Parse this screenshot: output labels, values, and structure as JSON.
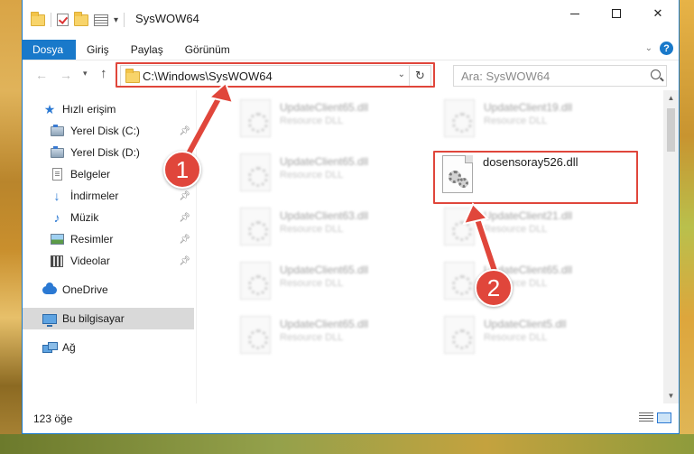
{
  "window": {
    "title": "SysWOW64",
    "controls": {
      "minimize": "minimize",
      "maximize": "maximize",
      "close": "✕"
    }
  },
  "ribbon": {
    "tabs": [
      {
        "label": "Dosya",
        "active": true
      },
      {
        "label": "Giriş"
      },
      {
        "label": "Paylaş"
      },
      {
        "label": "Görünüm"
      }
    ]
  },
  "address": {
    "path": "C:\\Windows\\SysWOW64",
    "search_placeholder": "Ara: SysWOW64"
  },
  "nav": {
    "items": [
      {
        "label": "Hızlı erişim",
        "icon": "star-icon",
        "pinned": false
      },
      {
        "label": "Yerel Disk (C:)",
        "icon": "drive-icon",
        "pinned": true
      },
      {
        "label": "Yerel Disk (D:)",
        "icon": "drive-icon",
        "pinned": false
      },
      {
        "label": "Belgeler",
        "icon": "documents-icon",
        "pinned": true
      },
      {
        "label": "İndirmeler",
        "icon": "download-icon",
        "pinned": true
      },
      {
        "label": "Müzik",
        "icon": "music-icon",
        "pinned": true
      },
      {
        "label": "Resimler",
        "icon": "pictures-icon",
        "pinned": true
      },
      {
        "label": "Videolar",
        "icon": "videos-icon",
        "pinned": true
      },
      {
        "label": "OneDrive",
        "icon": "cloud-icon",
        "pinned": false
      },
      {
        "label": "Bu bilgisayar",
        "icon": "computer-icon",
        "pinned": false,
        "selected": true
      },
      {
        "label": "Ağ",
        "icon": "network-icon",
        "pinned": false
      }
    ]
  },
  "files": {
    "blurred": [
      {
        "name": "UpdateClient65.dll",
        "type": "Resource DLL"
      },
      {
        "name": "UpdateClient19.dll",
        "type": "Resource DLL"
      },
      {
        "name": "UpdateClient65.dll",
        "type": "Resource DLL"
      },
      {
        "name": "UpdateClient63.dll",
        "type": "Resource DLL"
      },
      {
        "name": "UpdateClient21.dll",
        "type": "Resource DLL"
      },
      {
        "name": "UpdateClient65.dll",
        "type": "Resource DLL"
      },
      {
        "name": "UpdateClient65.dll",
        "type": "Resource DLL"
      },
      {
        "name": "UpdateClient65.dll",
        "type": "Resource DLL"
      },
      {
        "name": "UpdateClient5.dll",
        "type": "Resource DLL"
      }
    ],
    "highlighted": {
      "name": "dosensoray526.dll"
    }
  },
  "status": {
    "item_count": "123 öğe"
  },
  "annotations": {
    "step1": "1",
    "step2": "2",
    "accent": "#e0463b"
  }
}
